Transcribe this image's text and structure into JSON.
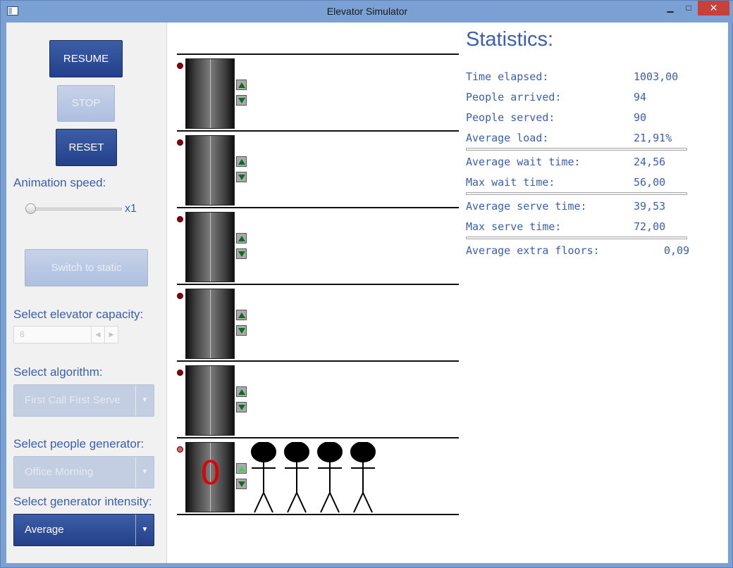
{
  "window": {
    "title": "Elevator Simulator",
    "controls": {
      "minimize": "▁",
      "maximize": "□",
      "close": "✕"
    }
  },
  "controls": {
    "resume_label": "RESUME",
    "stop_label": "STOP",
    "reset_label": "RESET",
    "animation_speed_label": "Animation speed:",
    "animation_speed_value": "x1",
    "animation_speed_level": 0,
    "switch_label": "Switch to static",
    "capacity_label": "Select elevator capacity:",
    "capacity_value": "8",
    "algorithm_label": "Select algorithm:",
    "algorithm_value": "First Call First Serve",
    "generator_label": "Select people generator:",
    "generator_value": "Office Morning",
    "intensity_label": "Select generator intensity:",
    "intensity_value": "Average"
  },
  "simulation": {
    "floors": [
      {
        "call_lit": false,
        "up_lit": false,
        "elevator_count": "",
        "people": 0
      },
      {
        "call_lit": false,
        "up_lit": false,
        "elevator_count": "",
        "people": 0
      },
      {
        "call_lit": false,
        "up_lit": false,
        "elevator_count": "",
        "people": 0
      },
      {
        "call_lit": false,
        "up_lit": false,
        "elevator_count": "",
        "people": 0
      },
      {
        "call_lit": false,
        "up_lit": false,
        "elevator_count": "",
        "people": 0
      },
      {
        "call_lit": true,
        "up_lit": true,
        "elevator_count": "0",
        "people": 4
      }
    ],
    "colors": {
      "indicator_dark": "#8b0000",
      "indicator_lit": "#e06060",
      "arrow_dark": "#0b6d1e",
      "arrow_lit": "#3fd44a",
      "count": "#e00000"
    }
  },
  "stats": {
    "title": "Statistics:",
    "rows": [
      {
        "label": "Time elapsed:",
        "value": "1003,00"
      },
      {
        "label": "People arrived:",
        "value": "94"
      },
      {
        "label": "People served:",
        "value": "90"
      },
      {
        "label": "Average load:",
        "value": "21,91%"
      },
      {
        "label": "Average wait time:",
        "value": "24,56"
      },
      {
        "label": "Max wait time:",
        "value": "56,00"
      },
      {
        "label": "Average serve time:",
        "value": "39,53"
      },
      {
        "label": "Max serve time:",
        "value": "72,00"
      },
      {
        "label": "Average extra floors:",
        "value": "0,09"
      }
    ]
  },
  "colors": {
    "accent": "#3a5fb0",
    "button_dark": "#23408a",
    "titlebar": "#7aa0d4",
    "close": "#c7413a"
  }
}
